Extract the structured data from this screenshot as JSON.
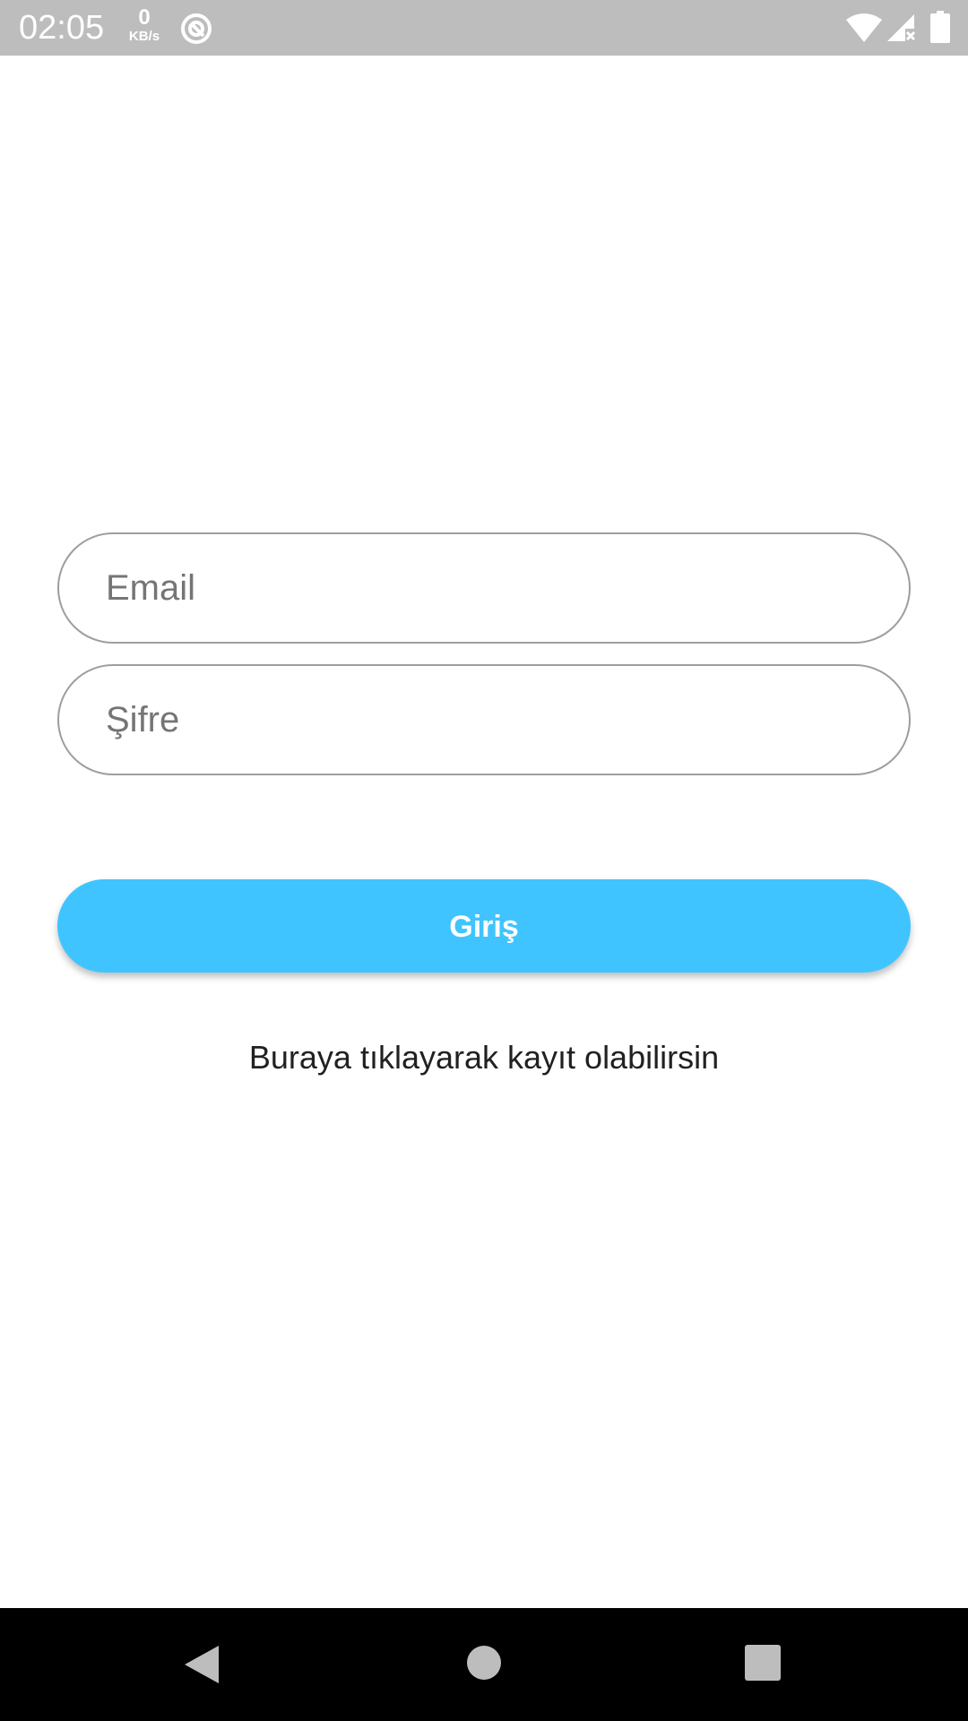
{
  "status_bar": {
    "time": "02:05",
    "net_speed_value": "0",
    "net_speed_unit": "KB/s",
    "icons": [
      "sync-icon",
      "wifi-icon",
      "signal-no-data-icon",
      "battery-icon"
    ]
  },
  "form": {
    "email_placeholder": "Email",
    "password_placeholder": "Şifre",
    "login_label": "Giriş",
    "register_link": "Buraya tıklayarak kayıt olabilirsin"
  },
  "nav_bar": {
    "icons": [
      "back-icon",
      "home-icon",
      "recents-icon"
    ]
  },
  "colors": {
    "status_bar": "#bdbdbd",
    "accent": "#40c4ff",
    "field_border": "#9e9e9e",
    "nav_bar": "#000000"
  }
}
